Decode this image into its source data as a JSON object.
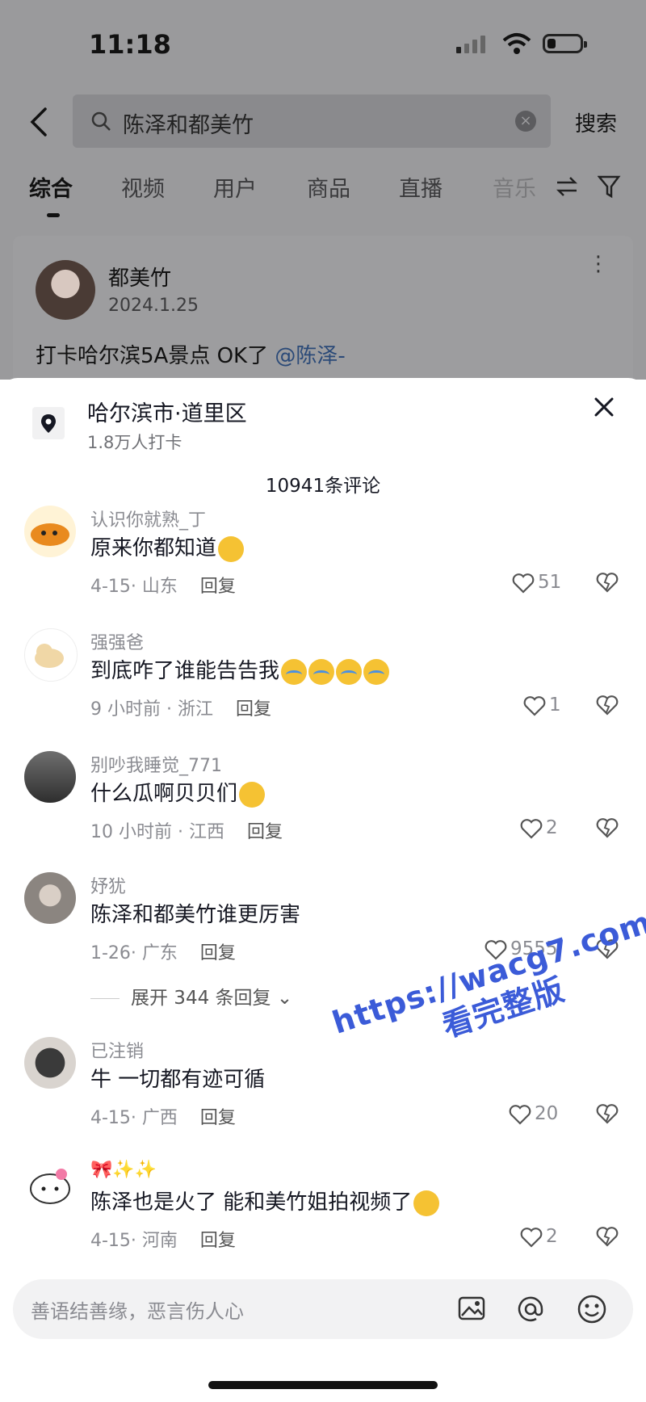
{
  "status": {
    "time": "11:18"
  },
  "search": {
    "query": "陈泽和都美竹",
    "button": "搜索"
  },
  "tabs": [
    {
      "label": "综合"
    },
    {
      "label": "视频"
    },
    {
      "label": "用户"
    },
    {
      "label": "商品"
    },
    {
      "label": "直播"
    },
    {
      "label": "音乐"
    }
  ],
  "post": {
    "author": "都美竹",
    "date": "2024.1.25",
    "text": "打卡哈尔滨5A景点 OK了",
    "mention": "@陈泽-"
  },
  "sheet": {
    "location": "哈尔滨市·道里区",
    "checkins": "1.8万人打卡",
    "comment_count": "10941条评论"
  },
  "comments": [
    {
      "user": "认识你就熟_丁",
      "text": "原来你都知道",
      "meta": "4-15· 山东",
      "reply": "回复",
      "likes": "51"
    },
    {
      "user": "强强爸",
      "text": "到底咋了谁能告告我",
      "meta": "9 小时前 · 浙江",
      "reply": "回复",
      "likes": "1"
    },
    {
      "user": "别吵我睡觉_771",
      "text": "什么瓜啊贝贝们",
      "meta": "10 小时前 · 江西",
      "reply": "回复",
      "likes": "2"
    },
    {
      "user": "妤犹",
      "text": "陈泽和都美竹谁更厉害",
      "meta": "1-26· 广东",
      "reply": "回复",
      "likes": "9555"
    },
    {
      "user": "已注销",
      "text": "牛 一切都有迹可循",
      "meta": "4-15· 广西",
      "reply": "回复",
      "likes": "20"
    },
    {
      "user": "🎀✨✨",
      "text": "陈泽也是火了 能和美竹姐拍视频了",
      "meta": "4-15· 河南",
      "reply": "回复",
      "likes": "2"
    }
  ],
  "expand_replies": "展开 344 条回复",
  "watermark": {
    "line1": "https://wacg7.com",
    "line2": "看完整版"
  },
  "input": {
    "placeholder": "善语结善缘，恶言伤人心"
  }
}
